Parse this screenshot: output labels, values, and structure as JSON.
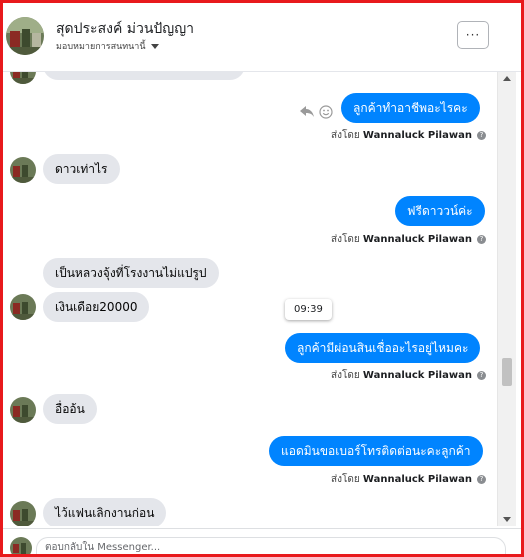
{
  "header": {
    "page_name": "สุดประสงค์ ม่วนปัญญา",
    "subtitle": "มอบหมายการสนทนานี้",
    "more_label": "···"
  },
  "messages": [
    {
      "dir": "in",
      "text": ""
    },
    {
      "dir": "out",
      "text": "ลูกค้าทำอาชีพอะไรคะ",
      "sent_prefix": "ส่งโดย",
      "sent_by": "Wannaluck Pilawan"
    },
    {
      "dir": "in",
      "text": "ดาวเท่าไร"
    },
    {
      "dir": "out",
      "text": "ฟรีดาววน์ค่ะ",
      "sent_prefix": "ส่งโดย",
      "sent_by": "Wannaluck Pilawan"
    },
    {
      "dir": "in",
      "text": "เป็นหลวงจุ้งที่โรงงานไม่แปรูป"
    },
    {
      "dir": "in",
      "text": "เงินเดือย20000"
    },
    {
      "dir": "out",
      "text": "ลูกค้ามีผ่อนสินเชื่ออะไรอยู่ไหมคะ",
      "sent_prefix": "ส่งโดย",
      "sent_by": "Wannaluck Pilawan"
    },
    {
      "dir": "in",
      "text": "อื่ออ้น"
    },
    {
      "dir": "out",
      "text": "แอดมินขอเบอร์โทรติดต่อนะคะลูกค้า",
      "sent_prefix": "ส่งโดย",
      "sent_by": "Wannaluck Pilawan"
    },
    {
      "dir": "in",
      "text": "ไว้แฟนเลิกงานก่อน"
    }
  ],
  "time_tooltip": "09:39",
  "help_glyph": "?",
  "footer": {
    "placeholder": "ตอบกลับใน Messenger..."
  },
  "colors": {
    "frame_border": "#e8191c",
    "outgoing_bubble": "#0084ff",
    "incoming_bubble": "#e4e6eb"
  },
  "icons": [
    "profile-avatar",
    "chevron-down-icon",
    "more-options-icon",
    "reply-icon",
    "smiley-icon",
    "help-icon"
  ]
}
